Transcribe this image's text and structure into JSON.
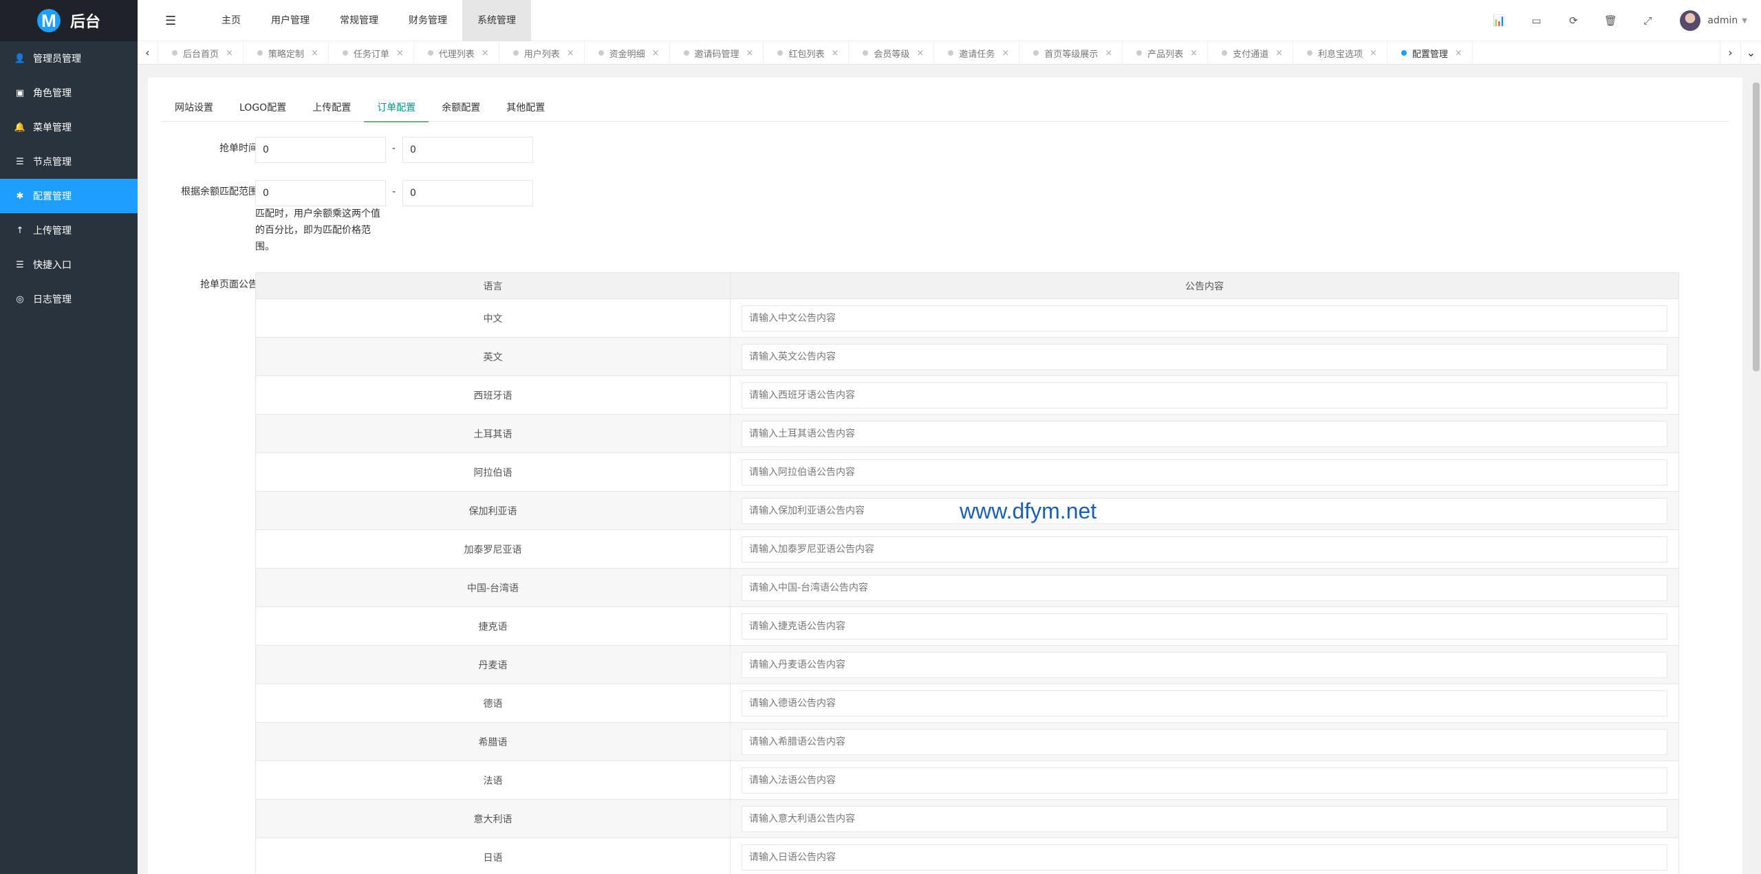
{
  "app": {
    "logo_letter": "M",
    "title": "后台"
  },
  "sidebar": {
    "items": [
      {
        "label": "管理员管理",
        "icon": "user-icon",
        "glyph": "👤"
      },
      {
        "label": "角色管理",
        "icon": "role-icon",
        "glyph": "▣"
      },
      {
        "label": "菜单管理",
        "icon": "menu-bell-icon",
        "glyph": "🔔"
      },
      {
        "label": "节点管理",
        "icon": "list-icon",
        "glyph": "☰"
      },
      {
        "label": "配置管理",
        "icon": "gear-icon",
        "glyph": "✱",
        "active": true
      },
      {
        "label": "上传管理",
        "icon": "upload-icon",
        "glyph": "↑"
      },
      {
        "label": "快捷入口",
        "icon": "shortcut-list-icon",
        "glyph": "☰"
      },
      {
        "label": "日志管理",
        "icon": "log-icon",
        "glyph": "◎"
      }
    ]
  },
  "header": {
    "menu": [
      "主页",
      "用户管理",
      "常规管理",
      "财务管理",
      "系统管理"
    ],
    "active_menu": "系统管理",
    "user": "admin"
  },
  "tabs": {
    "items": [
      "后台首页",
      "策略定制",
      "任务订单",
      "代理列表",
      "用户列表",
      "资金明细",
      "邀请码管理",
      "红包列表",
      "会员等级",
      "邀请任务",
      "首页等级展示",
      "产品列表",
      "支付通道",
      "利息宝选项",
      "配置管理"
    ],
    "active": "配置管理"
  },
  "config": {
    "subtabs": [
      "网站设置",
      "LOGO配置",
      "上传配置",
      "订单配置",
      "余额配置",
      "其他配置"
    ],
    "active_subtab": "订单配置",
    "grab_time": {
      "label": "抢单时间",
      "from": "0",
      "to": "0",
      "separator": "-"
    },
    "balance_range": {
      "label": "根据余额匹配范围",
      "from": "0",
      "to": "0",
      "separator": "-",
      "hint": "匹配时，用户余额乘这两个值的百分比，即为匹配价格范围。"
    },
    "announcement": {
      "label": "抢单页面公告",
      "col_lang": "语言",
      "col_content": "公告内容",
      "rows": [
        {
          "lang": "中文",
          "placeholder": "请输入中文公告内容"
        },
        {
          "lang": "英文",
          "placeholder": "请输入英文公告内容"
        },
        {
          "lang": "西班牙语",
          "placeholder": "请输入西班牙语公告内容"
        },
        {
          "lang": "土耳其语",
          "placeholder": "请输入土耳其语公告内容"
        },
        {
          "lang": "阿拉伯语",
          "placeholder": "请输入阿拉伯语公告内容"
        },
        {
          "lang": "保加利亚语",
          "placeholder": "请输入保加利亚语公告内容"
        },
        {
          "lang": "加泰罗尼亚语",
          "placeholder": "请输入加泰罗尼亚语公告内容"
        },
        {
          "lang": "中国-台湾语",
          "placeholder": "请输入中国-台湾语公告内容"
        },
        {
          "lang": "捷克语",
          "placeholder": "请输入捷克语公告内容"
        },
        {
          "lang": "丹麦语",
          "placeholder": "请输入丹麦语公告内容"
        },
        {
          "lang": "德语",
          "placeholder": "请输入德语公告内容"
        },
        {
          "lang": "希腊语",
          "placeholder": "请输入希腊语公告内容"
        },
        {
          "lang": "法语",
          "placeholder": "请输入法语公告内容"
        },
        {
          "lang": "意大利语",
          "placeholder": "请输入意大利语公告内容"
        },
        {
          "lang": "日语",
          "placeholder": "请输入日语公告内容"
        }
      ]
    }
  },
  "watermark": "www.dfym.net",
  "colors": {
    "sidebar_bg": "#28333e",
    "accent": "#1e9fff",
    "subtab_active": "#009688"
  }
}
